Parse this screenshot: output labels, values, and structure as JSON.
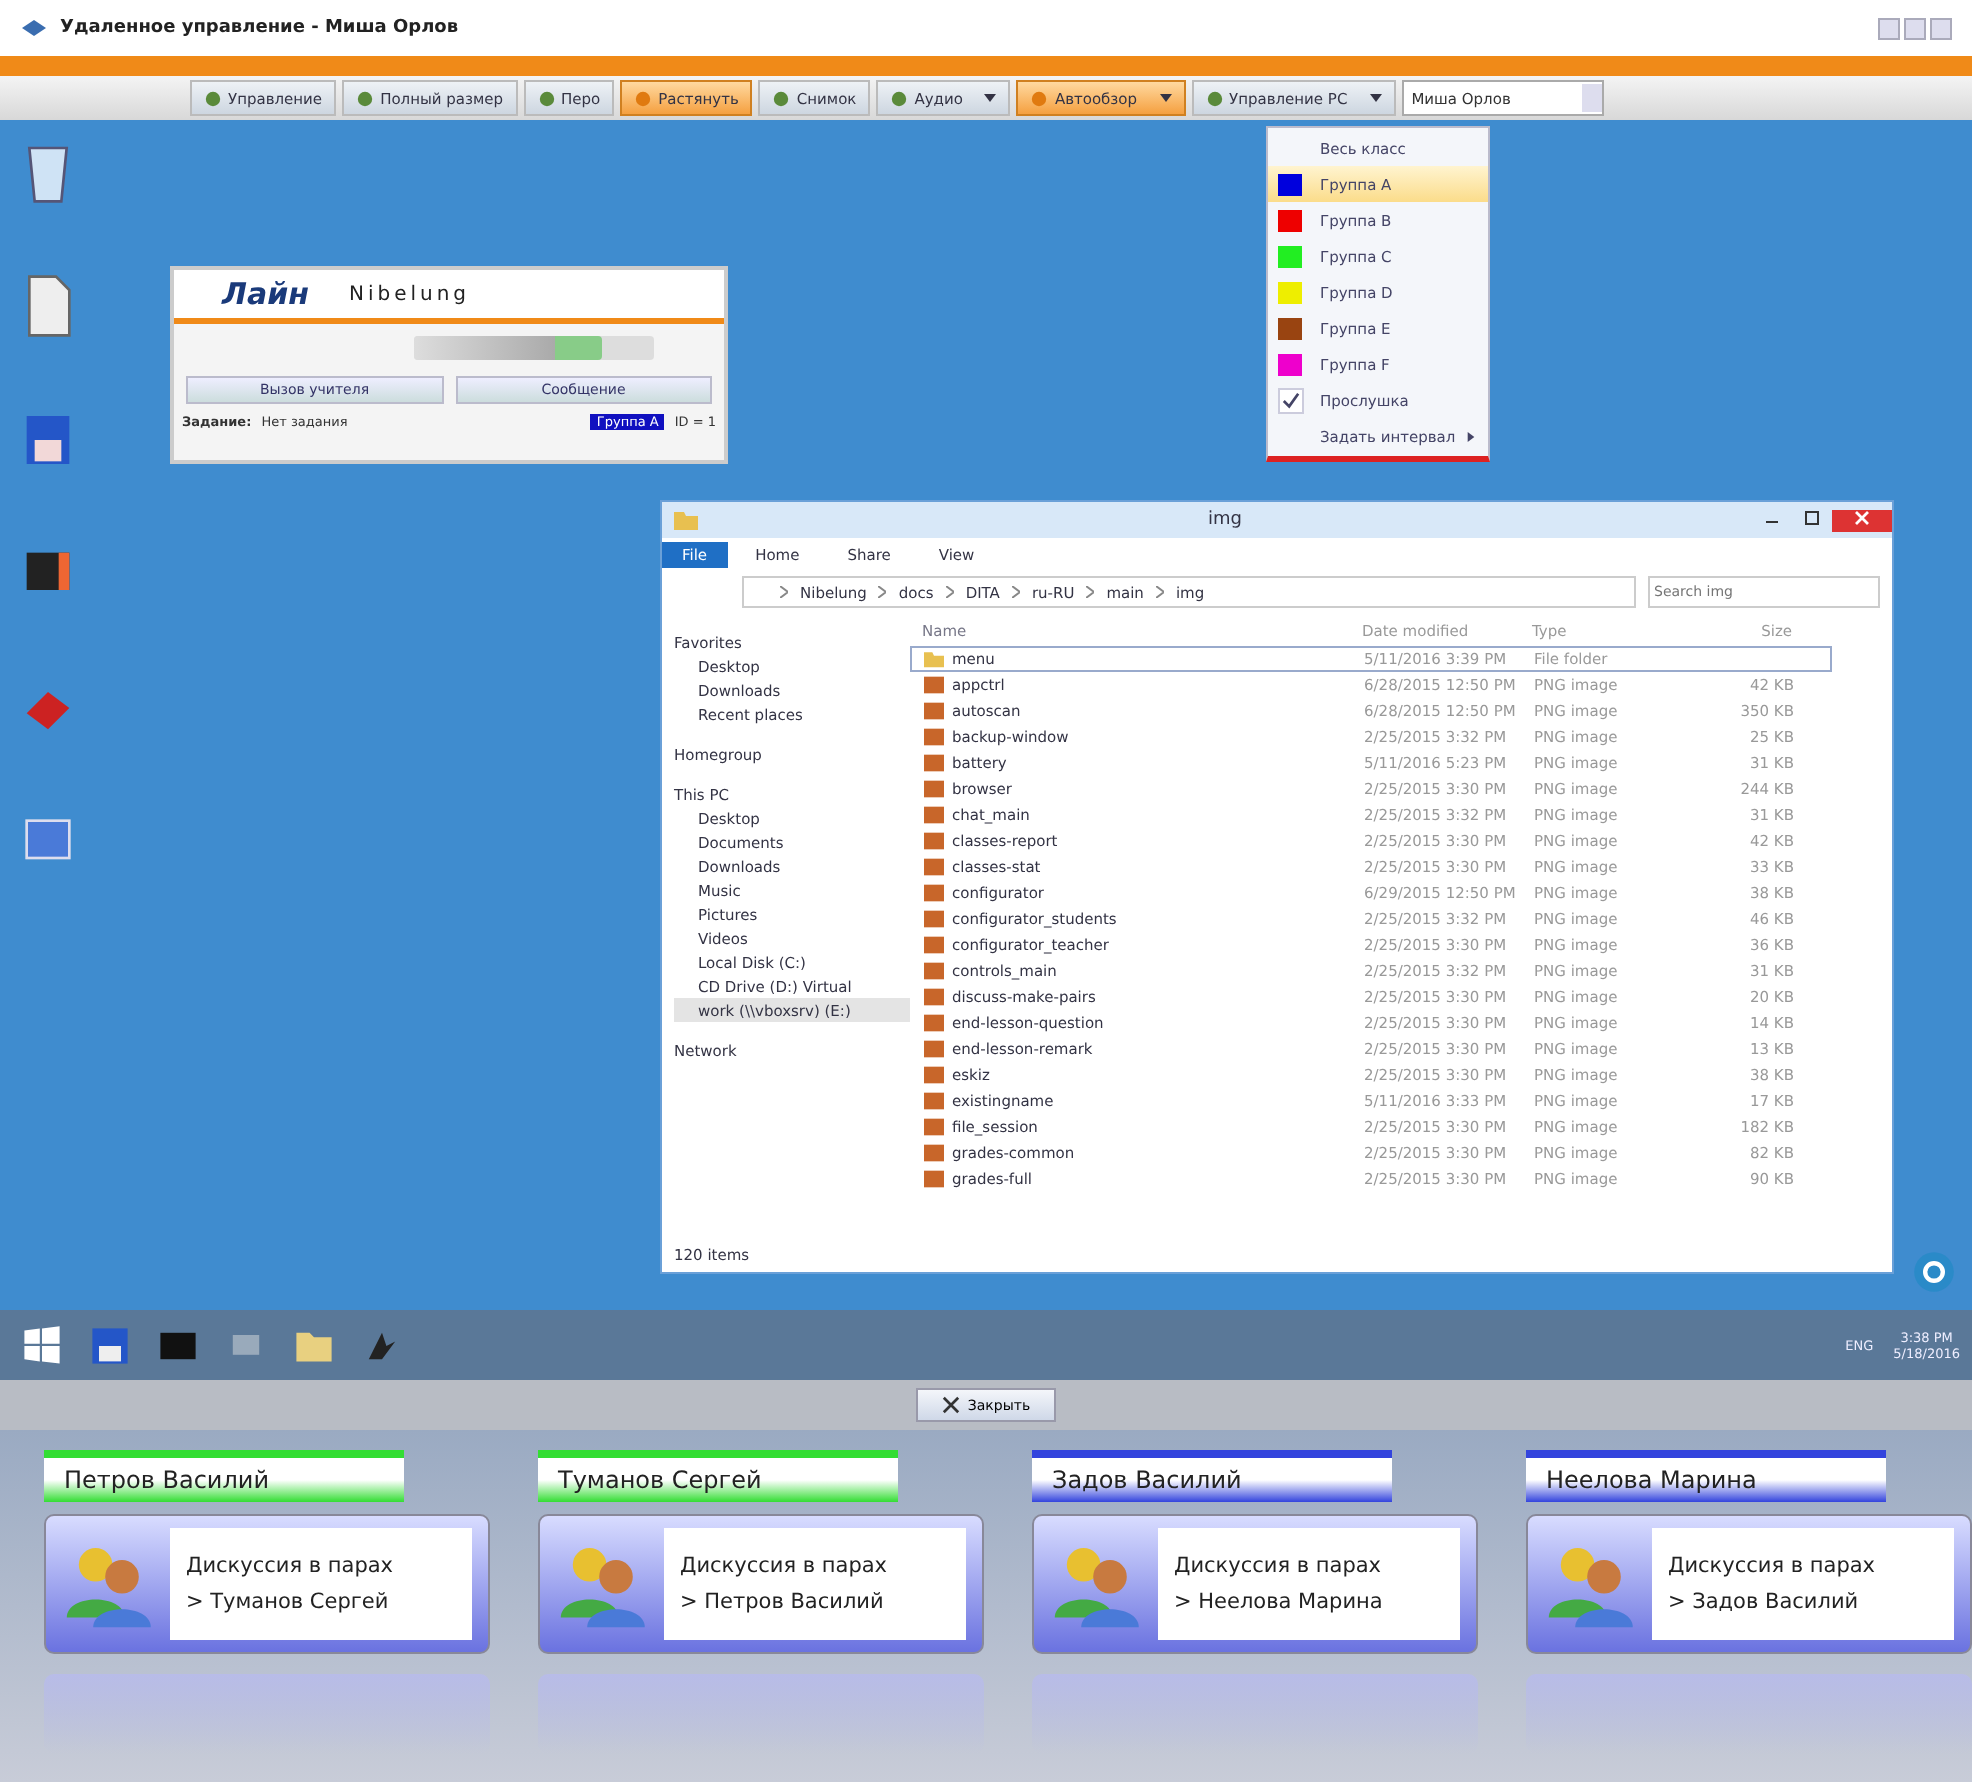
{
  "window": {
    "title": "Удаленное управление - Миша Орлов"
  },
  "toolbar": [
    {
      "label": "Управление",
      "kind": "button",
      "selected": false
    },
    {
      "label": "Полный размер",
      "kind": "button",
      "selected": false
    },
    {
      "label": "Перо",
      "kind": "button",
      "selected": false
    },
    {
      "label": "Растянуть",
      "kind": "button",
      "selected": true
    },
    {
      "label": "Снимок",
      "kind": "button",
      "selected": false
    },
    {
      "label": "Аудио",
      "kind": "dropdown",
      "selected": false
    },
    {
      "label": "Автообзор",
      "kind": "dropdown",
      "selected": true
    },
    {
      "label": "Управление PC",
      "kind": "dropdown",
      "selected": false
    },
    {
      "label": "Миша Орлов",
      "kind": "field",
      "selected": false
    }
  ],
  "menu": [
    {
      "label": "Весь класс",
      "kind": "plain",
      "selected": false
    },
    {
      "label": "Группа A",
      "kind": "group",
      "color": "#0000dd",
      "selected": true
    },
    {
      "label": "Группа B",
      "kind": "group",
      "color": "#ee0000",
      "selected": false
    },
    {
      "label": "Группа C",
      "kind": "group",
      "color": "#22ee22",
      "selected": false
    },
    {
      "label": "Группа D",
      "kind": "group",
      "color": "#eeee00",
      "selected": false
    },
    {
      "label": "Группа E",
      "kind": "group",
      "color": "#994411",
      "selected": false
    },
    {
      "label": "Группа F",
      "kind": "group",
      "color": "#ee00cc",
      "selected": false
    },
    {
      "label": "Прослушка",
      "kind": "check",
      "checked": true,
      "selected": false
    },
    {
      "label": "Задать интервал",
      "kind": "submenu",
      "selected": false
    }
  ],
  "widget": {
    "logo": "Лайн",
    "brand": "Nibelung",
    "call_button": "Вызов учителя",
    "message_button": "Сообщение",
    "task_label": "Задание:",
    "task_value": "Нет задания",
    "group": "Группа A",
    "id": "ID = 1",
    "volume": {
      "level": 0.78
    }
  },
  "explorer": {
    "title": "img",
    "ribbon_tabs": [
      {
        "label": "File",
        "selected": true
      },
      {
        "label": "Home",
        "selected": false
      },
      {
        "label": "Share",
        "selected": false
      },
      {
        "label": "View",
        "selected": false
      }
    ],
    "path": [
      "Nibelung",
      "docs",
      "DITA",
      "ru-RU",
      "main",
      "img"
    ],
    "search": {
      "placeholder": "Search img"
    },
    "nav": [
      {
        "label": "Favorites",
        "selected": false,
        "children": [
          {
            "label": "Desktop",
            "selected": false
          },
          {
            "label": "Downloads",
            "selected": false
          },
          {
            "label": "Recent places",
            "selected": false
          }
        ]
      },
      {
        "label": "Homegroup",
        "selected": false
      },
      {
        "label": "This PC",
        "selected": false,
        "children": [
          {
            "label": "Desktop",
            "selected": false
          },
          {
            "label": "Documents",
            "selected": false
          },
          {
            "label": "Downloads",
            "selected": false
          },
          {
            "label": "Music",
            "selected": false
          },
          {
            "label": "Pictures",
            "selected": false
          },
          {
            "label": "Videos",
            "selected": false
          },
          {
            "label": "Local Disk (C:)",
            "selected": false
          },
          {
            "label": "CD Drive (D:) Virtual",
            "selected": false
          },
          {
            "label": "work (\\\\vboxsrv) (E:)",
            "selected": true
          }
        ]
      },
      {
        "label": "Network",
        "selected": false
      }
    ],
    "columns": [
      "Name",
      "Date modified",
      "Type",
      "Size"
    ],
    "rows": [
      {
        "name": "menu",
        "kind": "folder",
        "date": "5/11/2016 3:39 PM",
        "type": "File folder",
        "selected": true
      },
      {
        "name": "appctrl",
        "kind": "image",
        "date": "6/28/2015 12:50 PM",
        "type": "PNG image",
        "size": "42 KB",
        "selected": false
      },
      {
        "name": "autoscan",
        "kind": "image",
        "date": "6/28/2015 12:50 PM",
        "type": "PNG image",
        "size": "350 KB",
        "selected": false
      },
      {
        "name": "backup-window",
        "kind": "image",
        "date": "2/25/2015 3:32 PM",
        "type": "PNG image",
        "size": "25 KB",
        "selected": false
      },
      {
        "name": "battery",
        "kind": "image",
        "date": "5/11/2016 5:23 PM",
        "type": "PNG image",
        "size": "31 KB",
        "selected": false
      },
      {
        "name": "browser",
        "kind": "image",
        "date": "2/25/2015 3:30 PM",
        "type": "PNG image",
        "size": "244 KB",
        "selected": false
      },
      {
        "name": "chat_main",
        "kind": "image",
        "date": "2/25/2015 3:32 PM",
        "type": "PNG image",
        "size": "31 KB",
        "selected": false
      },
      {
        "name": "classes-report",
        "kind": "image",
        "date": "2/25/2015 3:30 PM",
        "type": "PNG image",
        "size": "42 KB",
        "selected": false
      },
      {
        "name": "classes-stat",
        "kind": "image",
        "date": "2/25/2015 3:30 PM",
        "type": "PNG image",
        "size": "33 KB",
        "selected": false
      },
      {
        "name": "configurator",
        "kind": "image",
        "date": "6/29/2015 12:50 PM",
        "type": "PNG image",
        "size": "38 KB",
        "selected": false
      },
      {
        "name": "configurator_students",
        "kind": "image",
        "date": "2/25/2015 3:32 PM",
        "type": "PNG image",
        "size": "46 KB",
        "selected": false
      },
      {
        "name": "configurator_teacher",
        "kind": "image",
        "date": "2/25/2015 3:30 PM",
        "type": "PNG image",
        "size": "36 KB",
        "selected": false
      },
      {
        "name": "controls_main",
        "kind": "image",
        "date": "2/25/2015 3:32 PM",
        "type": "PNG image",
        "size": "31 KB",
        "selected": false
      },
      {
        "name": "discuss-make-pairs",
        "kind": "image",
        "date": "2/25/2015 3:30 PM",
        "type": "PNG image",
        "size": "20 KB",
        "selected": false
      },
      {
        "name": "end-lesson-question",
        "kind": "image",
        "date": "2/25/2015 3:30 PM",
        "type": "PNG image",
        "size": "14 KB",
        "selected": false
      },
      {
        "name": "end-lesson-remark",
        "kind": "image",
        "date": "2/25/2015 3:30 PM",
        "type": "PNG image",
        "size": "13 KB",
        "selected": false
      },
      {
        "name": "eskiz",
        "kind": "image",
        "date": "2/25/2015 3:30 PM",
        "type": "PNG image",
        "size": "38 KB",
        "selected": false
      },
      {
        "name": "existingname",
        "kind": "image",
        "date": "5/11/2016 3:33 PM",
        "type": "PNG image",
        "size": "17 KB",
        "selected": false
      },
      {
        "name": "file_session",
        "kind": "image",
        "date": "2/25/2015 3:30 PM",
        "type": "PNG image",
        "size": "182 KB",
        "selected": false
      },
      {
        "name": "grades-common",
        "kind": "image",
        "date": "2/25/2015 3:30 PM",
        "type": "PNG image",
        "size": "82 KB",
        "selected": false
      },
      {
        "name": "grades-full",
        "kind": "image",
        "date": "2/25/2015 3:30 PM",
        "type": "PNG image",
        "size": "90 KB",
        "selected": false
      }
    ],
    "status": "120 items"
  },
  "tray": {
    "language": "ENG",
    "time": "3:38 PM",
    "date": "5/18/2016"
  },
  "close_button": "Закрыть",
  "students": [
    {
      "name": "Петров Василий",
      "color": "#33dd33",
      "activity": "Дискуссия в парах",
      "partner": "> Туманов Сергей"
    },
    {
      "name": "Туманов Сергей",
      "color": "#33dd33",
      "activity": "Дискуссия в парах",
      "partner": "> Петров Василий"
    },
    {
      "name": "Задов Василий",
      "color": "#3344dd",
      "activity": "Дискуссия в парах",
      "partner": "> Неелова Марина"
    },
    {
      "name": "Неелова Марина",
      "color": "#3344dd",
      "activity": "Дискуссия в парах",
      "partner": "> Задов Василий"
    }
  ]
}
